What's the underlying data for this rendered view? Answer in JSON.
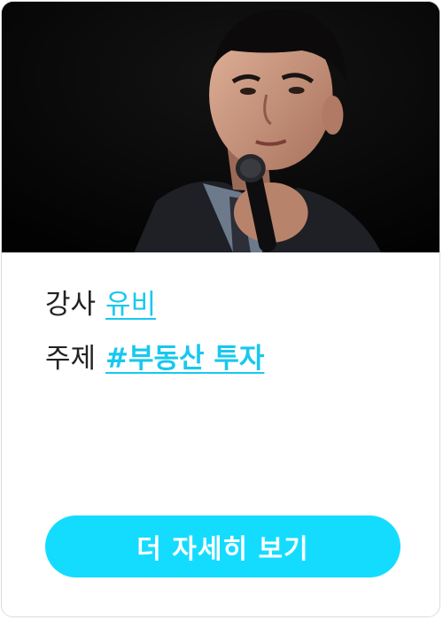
{
  "card": {
    "photo_alt": "강사 유비",
    "instructor": {
      "label": "강사",
      "name": "유비"
    },
    "topic": {
      "label": "주제",
      "tag": "#부동산 투자"
    },
    "cta_label": "더 자세히 보기",
    "colors": {
      "accent": "#17c8ef",
      "button": "#13dcff"
    }
  }
}
